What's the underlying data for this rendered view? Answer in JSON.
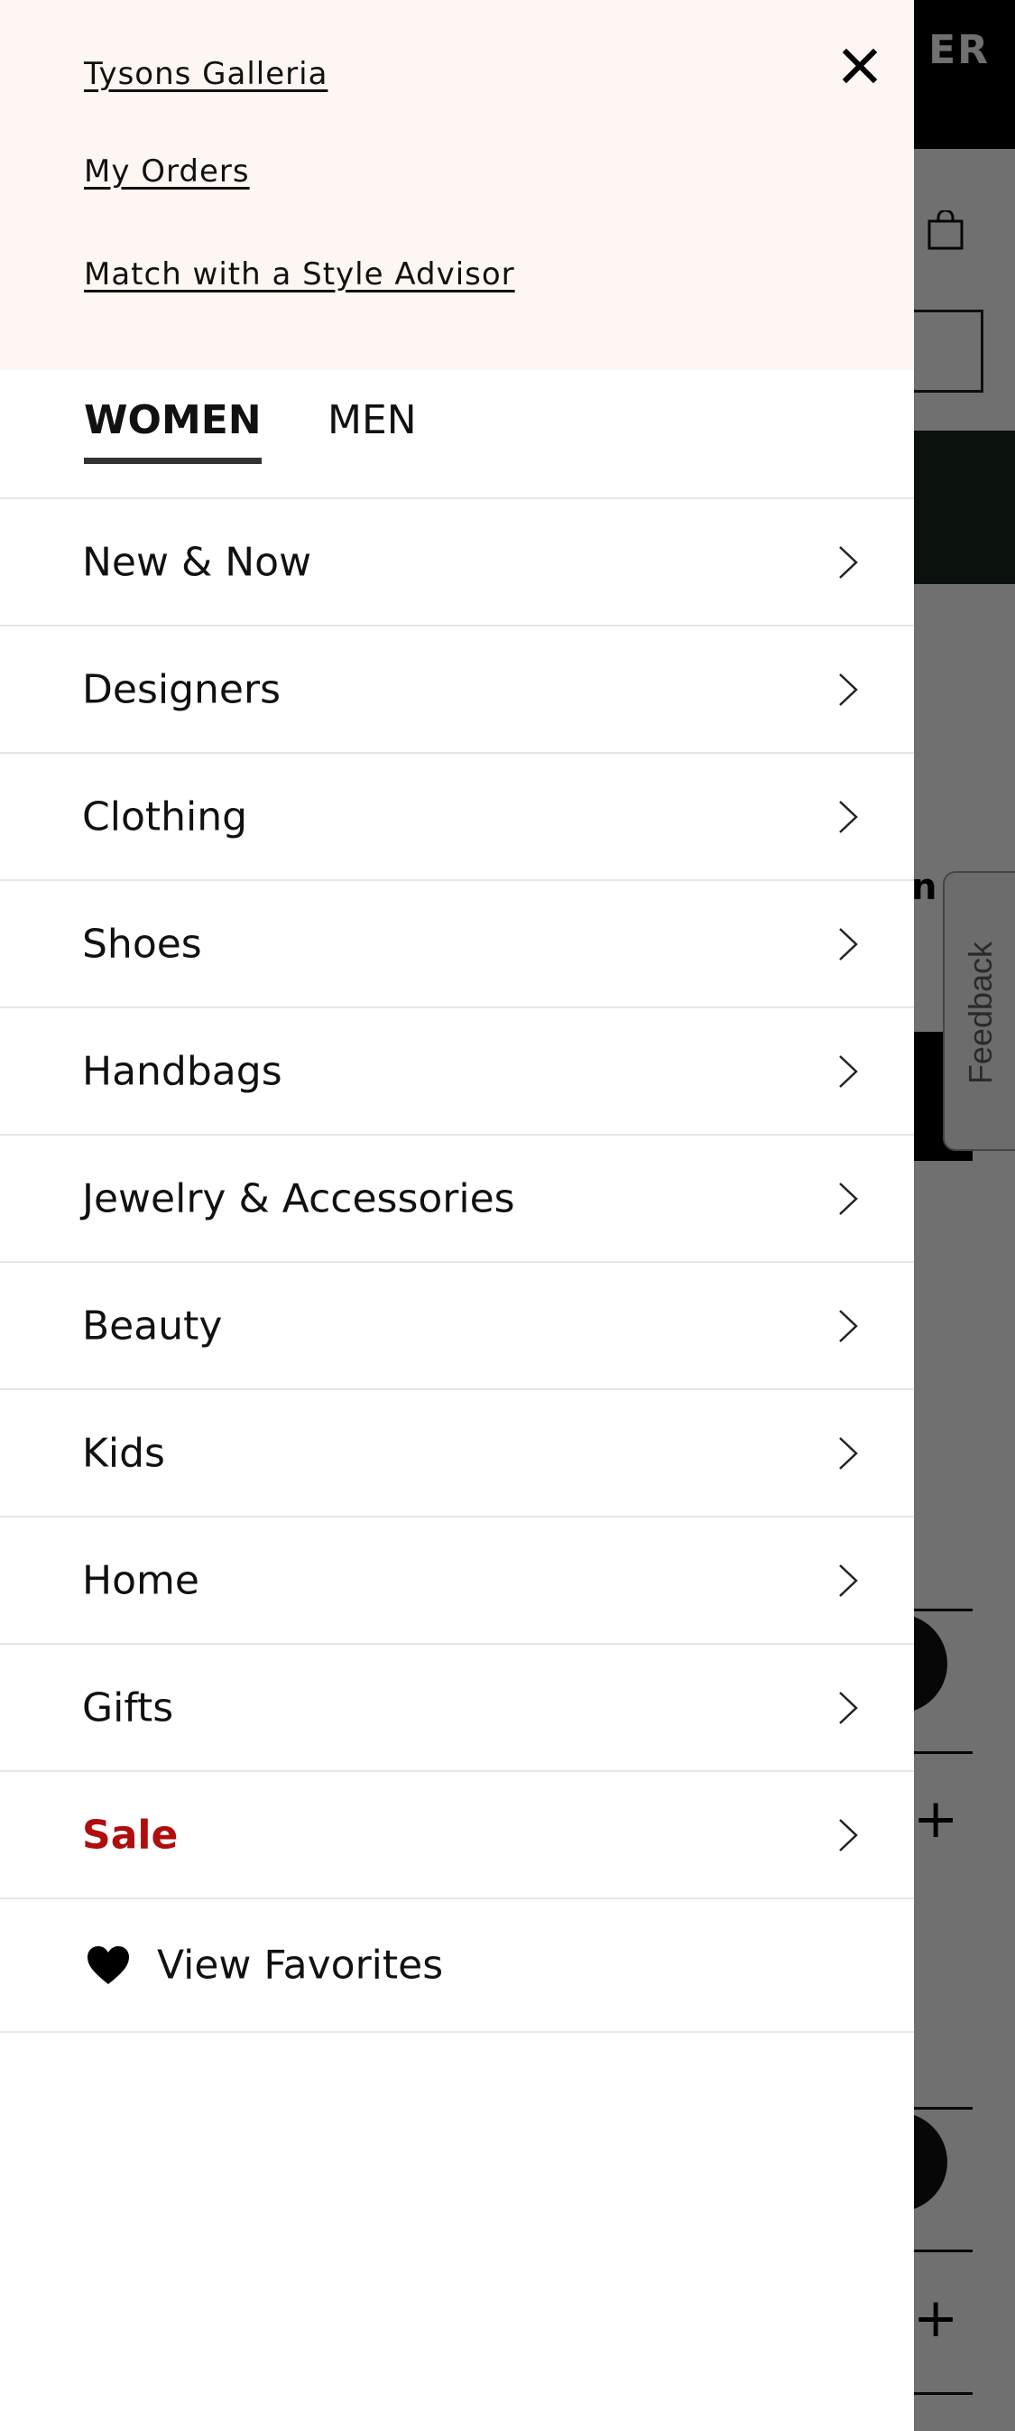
{
  "background": {
    "logo_fragment": "ER",
    "product_heading_fragment": "n",
    "feedback_label": "Feedback"
  },
  "drawer": {
    "top_links": [
      {
        "label": "Tysons Galleria"
      },
      {
        "label": "My Orders"
      },
      {
        "label": "Match with a Style Advisor"
      }
    ],
    "close_icon": "close-icon",
    "tabs": [
      {
        "label": "WOMEN",
        "active": true
      },
      {
        "label": "MEN",
        "active": false
      }
    ],
    "menu_items": [
      {
        "label": "New & Now"
      },
      {
        "label": "Designers"
      },
      {
        "label": "Clothing"
      },
      {
        "label": "Shoes"
      },
      {
        "label": "Handbags"
      },
      {
        "label": "Jewelry & Accessories"
      },
      {
        "label": "Beauty"
      },
      {
        "label": "Kids"
      },
      {
        "label": "Home"
      },
      {
        "label": "Gifts"
      },
      {
        "label": "Sale"
      }
    ],
    "favorites": {
      "label": "View Favorites",
      "icon": "heart-icon"
    }
  },
  "colors": {
    "sale": "#b00e0e",
    "drawer_top_bg": "#fdf6f2",
    "overlay": "#707070"
  }
}
